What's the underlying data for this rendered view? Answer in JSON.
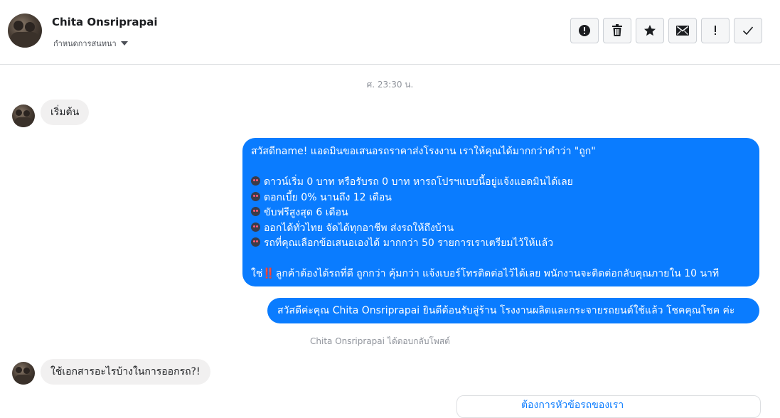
{
  "header": {
    "contact_name": "Chita Onsriprapai",
    "settings_label": "กำหนดการสนทนา",
    "actions": [
      {
        "name": "report-icon",
        "glyph": "!"
      },
      {
        "name": "trash-icon"
      },
      {
        "name": "star-icon"
      },
      {
        "name": "envelope-icon"
      },
      {
        "name": "exclamation-icon",
        "glyph": "!"
      },
      {
        "name": "checkmark-icon"
      }
    ]
  },
  "thread": {
    "timestamp": "ศ. 23:30 น.",
    "messages": [
      {
        "from": "customer",
        "text": "เริ่มต้น"
      },
      {
        "from": "page",
        "lines": [
          "สวัสดีname! แอดมินขอเสนอรถราคาส่งโรงงาน เราให้คุณได้มากกว่าคำว่า \"ถูก\"",
          "",
          "ดาวน์เริ่ม 0 บาท หรือรับรถ 0 บาท หารถโปรฯแบบนี้อยู่แจ้งแอดมินได้เลย",
          "ดอกเบี้ย 0% นานถึง 12 เดือน",
          "ขับฟรีสูงสุด 6 เดือน",
          "ออกได้ทั่วไทย จัดได้ทุกอาชีพ ส่งรถให้ถึงบ้าน",
          "รถที่คุณเลือกข้อเสนอเองได้ มากกว่า 50 รายการเราเตรียมไว้ให้แล้ว",
          "",
          "ใช่",
          "ลูกค้าต้องได้รถที่ดี ถูกกว่า คุ้มกว่า แจ้งเบอร์โทรติดต่อไว้ได้เลย พนักงานจะติดต่อกลับคุณภายใน 10 นาที"
        ],
        "emoji": "car-face-emoji",
        "bang": "‼️"
      },
      {
        "from": "page",
        "text": "สวัสดีค่ะคุณ Chita Onsriprapai ยินดีต้อนรับสู่ร้าน โรงงานผลิตและกระจายรถยนต์ใช้แล้ว โชคคุณโชค ค่ะ"
      },
      {
        "from": "system",
        "text": "Chita Onsriprapai ได้ตอบกลับโพสต์"
      },
      {
        "from": "customer",
        "text": "ใช้เอกสารอะไรบ้างในการออกรถ?!"
      },
      {
        "from": "page",
        "text": "ต้องการหัวข้อรถของเรา"
      }
    ]
  },
  "colors": {
    "outgoing_bubble": "#0a7cff",
    "incoming_bubble": "#f1f0f0",
    "meta_text": "#90949c"
  }
}
